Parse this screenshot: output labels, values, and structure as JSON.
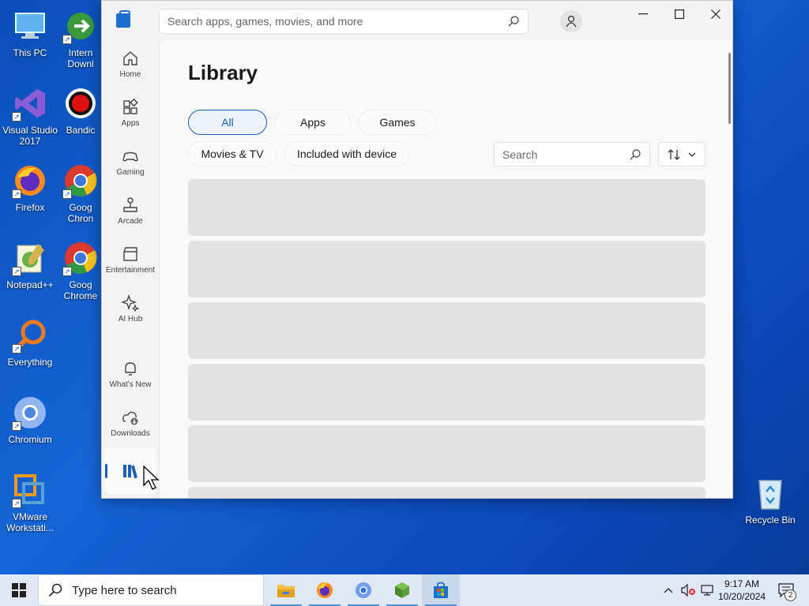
{
  "desktop": {
    "icons": [
      {
        "label": "This PC"
      },
      {
        "label": "Intern Downl"
      },
      {
        "label": "Visual Studio 2017"
      },
      {
        "label": "Bandic"
      },
      {
        "label": "Firefox"
      },
      {
        "label": "Goog Chron"
      },
      {
        "label": "Notepad++"
      },
      {
        "label": "Goog Chrome"
      },
      {
        "label": "Everything"
      },
      {
        "label": "Chromium"
      },
      {
        "label": "VMware Workstati..."
      },
      {
        "label": "Recycle Bin"
      }
    ]
  },
  "store": {
    "search_placeholder": "Search apps, games, movies, and more",
    "nav": [
      {
        "label": "Home",
        "icon": "home-icon"
      },
      {
        "label": "Apps",
        "icon": "apps-icon"
      },
      {
        "label": "Gaming",
        "icon": "gaming-icon"
      },
      {
        "label": "Arcade",
        "icon": "arcade-icon"
      },
      {
        "label": "Entertainment",
        "icon": "entertainment-icon"
      },
      {
        "label": "AI Hub",
        "icon": "ai-hub-icon"
      },
      {
        "label": "What's New",
        "icon": "whats-new-icon"
      },
      {
        "label": "Downloads",
        "icon": "downloads-icon"
      },
      {
        "label": "",
        "icon": "library-icon"
      }
    ],
    "page_title": "Library",
    "filters": [
      "All",
      "Apps",
      "Games",
      "Movies & TV",
      "Included with device"
    ],
    "active_filter": "All",
    "library_search_placeholder": "Search",
    "accent": "#1a5fb4"
  },
  "taskbar": {
    "search_placeholder": "Type here to search",
    "apps": [
      "file-explorer-icon",
      "firefox-icon",
      "chromium-icon",
      "minecraft-icon",
      "microsoft-store-icon"
    ],
    "time": "9:17 AM",
    "date": "10/20/2024",
    "notification_count": "2"
  }
}
